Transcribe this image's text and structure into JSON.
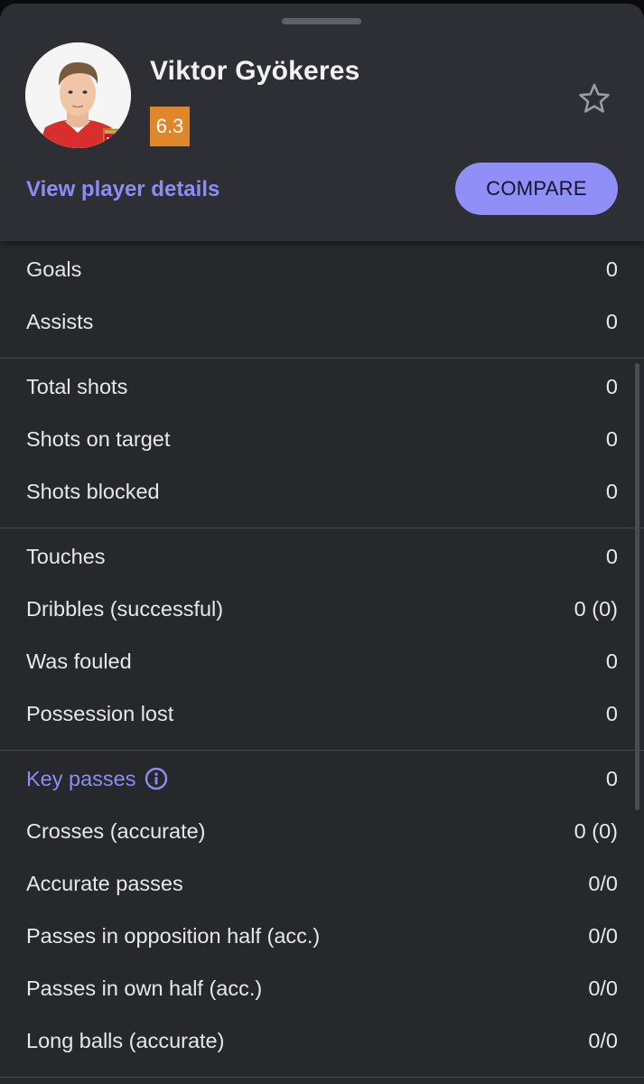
{
  "player": {
    "name": "Viktor Gyökeres",
    "rating": "6.3",
    "rating_color": "#e0872c",
    "club_badge_text": "Arsenal"
  },
  "actions": {
    "details_link": "View player details",
    "compare_label": "COMPARE"
  },
  "icons": {
    "favorite": "star-outline-icon",
    "info": "info-circle-icon"
  },
  "colors": {
    "accent": "#8f8ff7",
    "background": "#26282c",
    "header": "#2d2f34"
  },
  "stat_groups": [
    {
      "rows": [
        {
          "label": "Goals",
          "value": "0"
        },
        {
          "label": "Assists",
          "value": "0"
        }
      ]
    },
    {
      "rows": [
        {
          "label": "Total shots",
          "value": "0"
        },
        {
          "label": "Shots on target",
          "value": "0"
        },
        {
          "label": "Shots blocked",
          "value": "0"
        }
      ]
    },
    {
      "rows": [
        {
          "label": "Touches",
          "value": "0"
        },
        {
          "label": "Dribbles (successful)",
          "value": "0 (0)"
        },
        {
          "label": "Was fouled",
          "value": "0"
        },
        {
          "label": "Possession lost",
          "value": "0"
        }
      ]
    },
    {
      "rows": [
        {
          "label": "Key passes",
          "value": "0",
          "highlight": true,
          "info": true
        },
        {
          "label": "Crosses (accurate)",
          "value": "0 (0)"
        },
        {
          "label": "Accurate passes",
          "value": "0/0"
        },
        {
          "label": "Passes in opposition half (acc.)",
          "value": "0/0"
        },
        {
          "label": "Passes in own half (acc.)",
          "value": "0/0"
        },
        {
          "label": "Long balls (accurate)",
          "value": "0/0"
        }
      ]
    }
  ]
}
